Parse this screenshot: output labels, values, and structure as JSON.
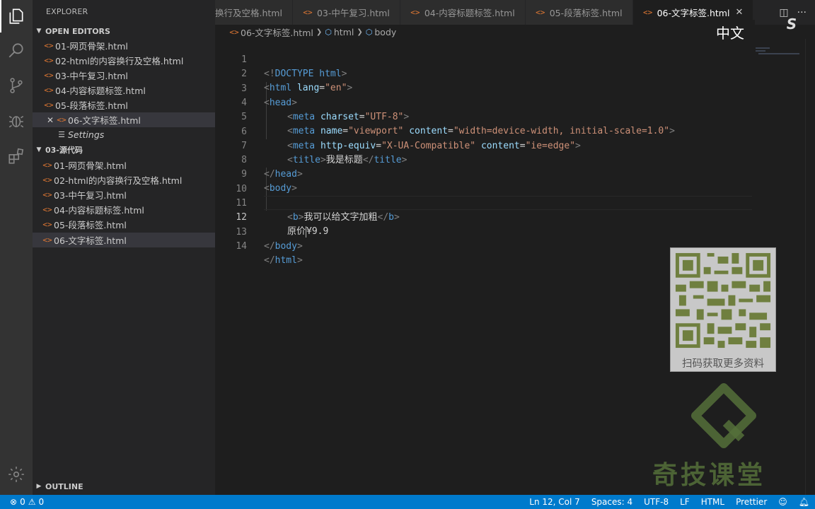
{
  "sidebar": {
    "title": "EXPLORER",
    "open_editors_header": "OPEN EDITORS",
    "open_editors": [
      {
        "label": "01-网页骨架.html"
      },
      {
        "label": "02-html的内容换行及空格.html"
      },
      {
        "label": "03-中午复习.html"
      },
      {
        "label": "04-内容标题标签.html"
      },
      {
        "label": "05-段落标签.html"
      },
      {
        "label": "06-文字标签.html"
      },
      {
        "label": "Settings"
      }
    ],
    "folder_header": "03-源代码",
    "folder_files": [
      {
        "label": "01-网页骨架.html"
      },
      {
        "label": "02-html的内容换行及空格.html"
      },
      {
        "label": "03-中午复习.html"
      },
      {
        "label": "04-内容标题标签.html"
      },
      {
        "label": "05-段落标签.html"
      },
      {
        "label": "06-文字标签.html"
      }
    ],
    "outline_header": "OUTLINE"
  },
  "tabs": [
    {
      "label": "换行及空格.html"
    },
    {
      "label": "03-中午复习.html"
    },
    {
      "label": "04-内容标题标签.html"
    },
    {
      "label": "05-段落标签.html"
    },
    {
      "label": "06-文字标签.html"
    }
  ],
  "breadcrumb": {
    "file": "06-文字标签.html",
    "crumb1": "html",
    "crumb2": "body"
  },
  "editor": {
    "line_numbers": [
      "1",
      "2",
      "3",
      "4",
      "5",
      "6",
      "7",
      "8",
      "9",
      "10",
      "11",
      "12",
      "13",
      "14"
    ],
    "l1": {
      "open": "<!",
      "tag": "DOCTYPE",
      "sp": " ",
      "attr": "html",
      "close": ">"
    },
    "l2": {
      "open": "<",
      "tag": "html",
      "attr": " lang",
      "eq": "=",
      "val": "\"en\"",
      "close": ">"
    },
    "l3": {
      "open": "<",
      "tag": "head",
      "close": ">"
    },
    "l4": {
      "open": "<",
      "tag": "meta",
      "attr": " charset",
      "eq": "=",
      "val": "\"UTF-8\"",
      "close": ">"
    },
    "l5": {
      "open": "<",
      "tag": "meta",
      "attr1": " name",
      "eq1": "=",
      "val1": "\"viewport\"",
      "attr2": " content",
      "eq2": "=",
      "val2": "\"width=device-width, initial-scale=1.0\"",
      "close": ">"
    },
    "l6": {
      "open": "<",
      "tag": "meta",
      "attr1": " http-equiv",
      "eq1": "=",
      "val1": "\"X-UA-Compatible\"",
      "attr2": " content",
      "eq2": "=",
      "val2": "\"ie=edge\"",
      "close": ">"
    },
    "l7": {
      "open": "<",
      "tag": "title",
      "close": ">",
      "text": "我是标题",
      "open2": "</",
      "tag2": "title",
      "close2": ">"
    },
    "l8": {
      "open": "</",
      "tag": "head",
      "close": ">"
    },
    "l9": {
      "open": "<",
      "tag": "body",
      "close": ">"
    },
    "l11": {
      "open": "<",
      "tag": "b",
      "close": ">",
      "text": "我可以给文字加粗",
      "open2": "</",
      "tag2": "b",
      "close2": ">"
    },
    "l12": {
      "text1": "原价",
      "text2": "¥9.9"
    },
    "l13": {
      "open": "</",
      "tag": "body",
      "close": ">"
    },
    "l14": {
      "open": "</",
      "tag": "html",
      "close": ">"
    }
  },
  "status": {
    "errors": "0",
    "warnings": "0",
    "position": "Ln 12, Col 7",
    "spaces": "Spaces: 4",
    "encoding": "UTF-8",
    "eol": "LF",
    "language": "HTML",
    "formatter": "Prettier"
  },
  "overlay": {
    "lang_badge": "中文",
    "qr_caption": "扫码获取更多资料",
    "watermark": "奇技课堂"
  },
  "colors": {
    "accent": "#007acc",
    "tag": "#569cd6",
    "attribute": "#9cdcfe",
    "string": "#ce9178",
    "html_file_icon": "#e37933"
  }
}
